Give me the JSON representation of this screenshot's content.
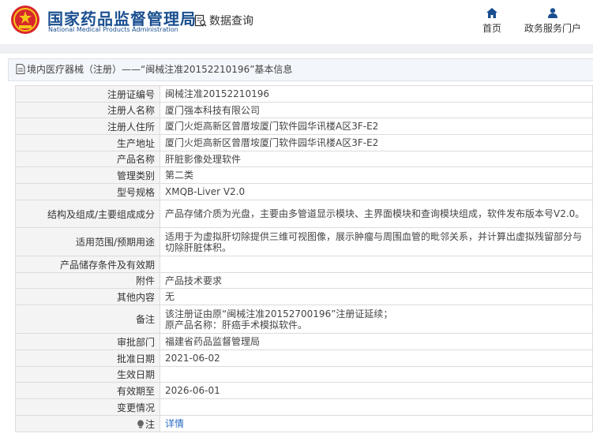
{
  "header": {
    "site_name": "国家药品监督管理局",
    "site_name_en": "National Medical Products Administration",
    "query_label": "数据查询",
    "nav": [
      {
        "label": "首页",
        "icon": "home-icon"
      },
      {
        "label": "政务服务门户",
        "icon": "user-icon"
      }
    ]
  },
  "breadcrumb": {
    "text": "境内医疗器械（注册）——“闽械注准20152210196”基本信息"
  },
  "colors": {
    "brand_blue": "#1a4f8f",
    "link_blue": "#2a6bc1",
    "emblem_red": "#d8262d"
  },
  "rows": [
    {
      "label": "注册证编号",
      "value": "闽械注准20152210196"
    },
    {
      "label": "注册人名称",
      "value": "厦门强本科技有限公司"
    },
    {
      "label": "注册人住所",
      "value": "厦门火炬高新区曾厝垵厦门软件园华讯楼A区3F-E2"
    },
    {
      "label": "生产地址",
      "value": "厦门火炬高新区曾厝垵厦门软件园华讯楼A区3F-E2"
    },
    {
      "label": "产品名称",
      "value": "肝脏影像处理软件"
    },
    {
      "label": "管理类别",
      "value": "第二类"
    },
    {
      "label": "型号规格",
      "value": "XMQB-Liver V2.0"
    },
    {
      "label": "结构及组成/主要组成成分",
      "value": "产品存储介质为光盘，主要由多管道显示模块、主界面模块和查询模块组成，软件发布版本号V2.0。"
    },
    {
      "label": "适用范围/预期用途",
      "value": "适用于为虚拟肝切除提供三维可视图像，展示肿瘤与周围血管的毗邻关系，并计算出虚拟残留部分与切除肝脏体积。"
    },
    {
      "label": "产品储存条件及有效期",
      "value": ""
    },
    {
      "label": "附件",
      "value": "产品技术要求"
    },
    {
      "label": "其他内容",
      "value": "无"
    },
    {
      "label": "备注",
      "value": "该注册证由原“闽械注准20152700196”注册证延续；\n原产品名称：肝癌手术模拟软件。"
    },
    {
      "label": "审批部门",
      "value": "福建省药品监督管理局"
    },
    {
      "label": "批准日期",
      "value": "2021-06-02"
    },
    {
      "label": "生效日期",
      "value": ""
    },
    {
      "label": "有效期至",
      "value": "2026-06-01"
    },
    {
      "label": "变更情况",
      "value": ""
    }
  ],
  "note_row": {
    "label": "注",
    "link": "详情"
  }
}
